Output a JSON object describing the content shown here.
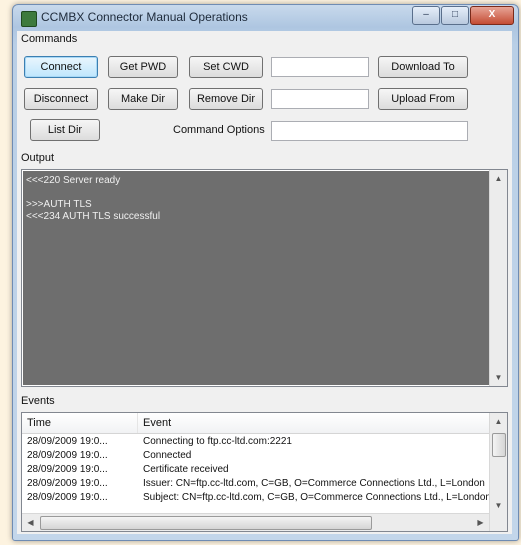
{
  "window": {
    "title": "CCMBX Connector Manual Operations",
    "minimize": "–",
    "maximize": "□",
    "close": "X"
  },
  "commands": {
    "group_label": "Commands",
    "connect": "Connect",
    "get_pwd": "Get PWD",
    "set_cwd": "Set CWD",
    "download_to": "Download To",
    "disconnect": "Disconnect",
    "make_dir": "Make Dir",
    "remove_dir": "Remove Dir",
    "upload_from": "Upload From",
    "list_dir": "List Dir",
    "command_options_label": "Command Options",
    "set_cwd_value": "",
    "remove_dir_value": "",
    "download_value": "",
    "command_options_value": ""
  },
  "output": {
    "label": "Output",
    "lines": [
      "<<<220 Server ready",
      "",
      ">>>AUTH TLS",
      "<<<234 AUTH TLS successful"
    ]
  },
  "events": {
    "label": "Events",
    "columns": [
      "Time",
      "Event"
    ],
    "rows": [
      [
        "28/09/2009 19:0...",
        "Connecting to ftp.cc-ltd.com:2221"
      ],
      [
        "28/09/2009 19:0...",
        "Connected"
      ],
      [
        "28/09/2009 19:0...",
        "Certificate received"
      ],
      [
        "28/09/2009 19:0...",
        "Issuer: CN=ftp.cc-ltd.com, C=GB, O=Commerce Connections Ltd., L=London"
      ],
      [
        "28/09/2009 19:0...",
        "Subject: CN=ftp.cc-ltd.com, C=GB, O=Commerce Connections Ltd., L=London"
      ]
    ]
  },
  "icons": {
    "app": "app-icon",
    "scroll_up": "▲",
    "scroll_down": "▼",
    "scroll_left": "◀",
    "scroll_right": "▶",
    "grip": "≡"
  }
}
